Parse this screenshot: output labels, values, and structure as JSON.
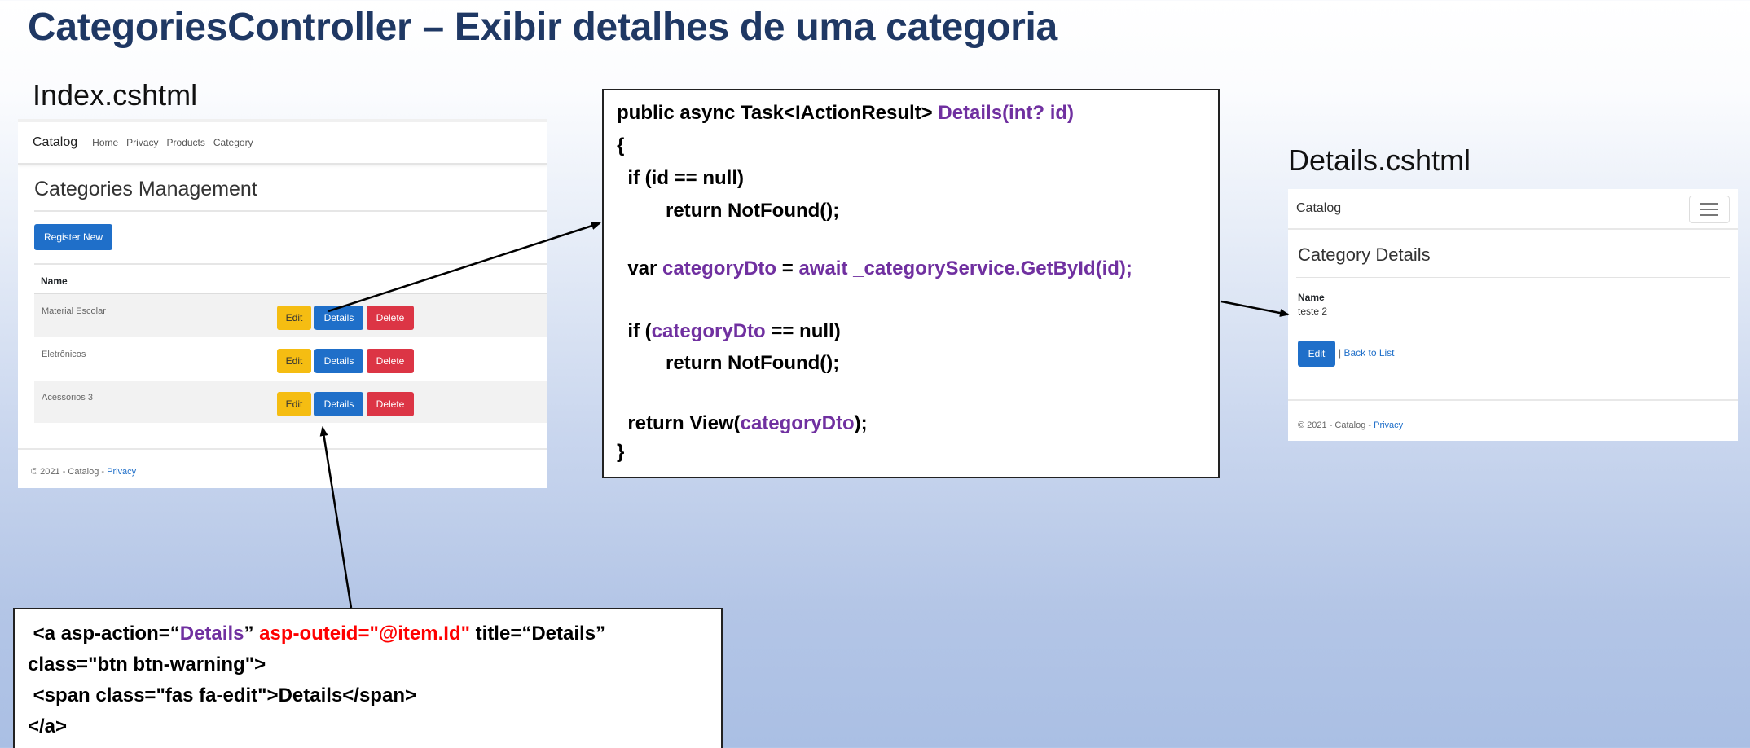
{
  "slide": {
    "title": "CategoriesController – Exibir detalhes de  uma categoria",
    "index_label": "Index.cshtml",
    "details_label": "Details.cshtml"
  },
  "index_page": {
    "brand": "Catalog",
    "nav": [
      "Home",
      "Privacy",
      "Products",
      "Category"
    ],
    "heading": "Categories Management",
    "register_button": "Register New",
    "column_header": "Name",
    "rows": [
      {
        "name": "Material Escolar"
      },
      {
        "name": "Eletrônicos"
      },
      {
        "name": "Acessorios 3"
      }
    ],
    "edit_label": "Edit",
    "details_label": "Details",
    "delete_label": "Delete",
    "footer_text": "© 2021 - Catalog - ",
    "footer_link": "Privacy"
  },
  "controller_code": {
    "l1a": "public async Task<IActionResult> ",
    "l1b": "Details(int? id)",
    "l2": "{",
    "l3": "  if (id == null)",
    "l4": "         return NotFound();",
    "l5a": "  var ",
    "l5b": "categoryDto",
    "l5c": " = ",
    "l5d": "await _categoryService.GetById(id);",
    "l6a": "  if (",
    "l6b": "categoryDto",
    "l6c": " == null)",
    "l7": "         return NotFound();",
    "l8a": "  return View(",
    "l8b": "categoryDto",
    "l8c": ");",
    "l9": "}"
  },
  "anchor_code": {
    "l1a": " <a asp-action=“",
    "l1b": "Details",
    "l1c": "” ",
    "l1d": "asp-outeid=\"@item.Id\"",
    "l1e": " title=“Details”",
    "l2": "class=\"btn btn-warning\">",
    "l3": " <span class=\"fas fa-edit\">Details</span>",
    "l4": "</a>"
  },
  "details_page": {
    "brand": "Catalog",
    "heading": "Category Details",
    "field_label": "Name",
    "field_value": "teste 2",
    "edit_button": "Edit",
    "separator": "|",
    "back_link": "Back to List",
    "footer_text": "© 2021 - Catalog - ",
    "footer_link": "Privacy"
  },
  "colors": {
    "title": "#1f3864",
    "keyword_purple": "#7030a0",
    "attribute_red": "#ff0000",
    "bootstrap_blue": "#1f6fc9",
    "bootstrap_yellow": "#f5bd12",
    "bootstrap_red": "#dc3545"
  }
}
